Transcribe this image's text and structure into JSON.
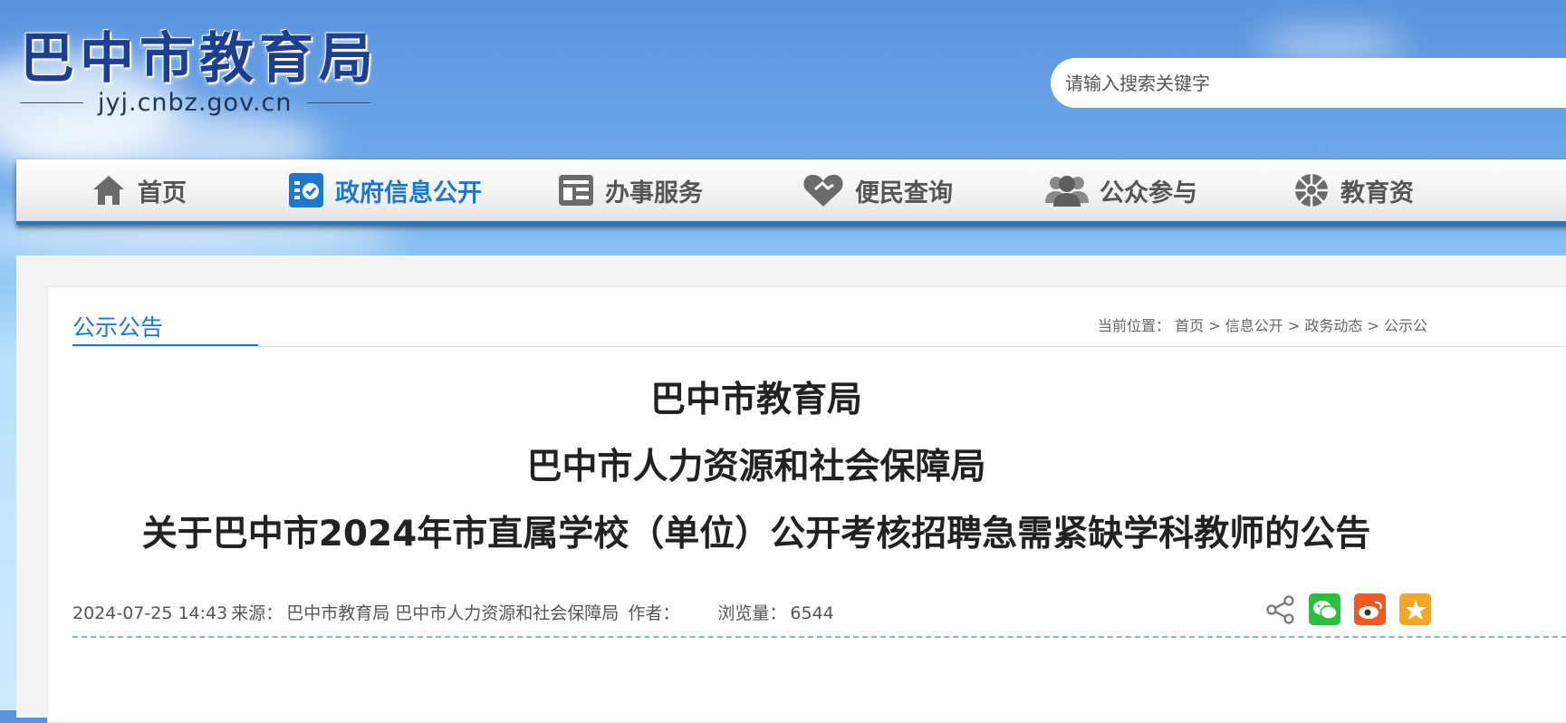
{
  "header": {
    "site_title": "巴中市教育局",
    "domain": "jyj.cnbz.gov.cn",
    "search_placeholder": "请输入搜索关键字"
  },
  "nav": {
    "items": [
      {
        "label": "首页",
        "icon": "home-icon"
      },
      {
        "label": "政府信息公开",
        "icon": "checklist-icon",
        "active": true
      },
      {
        "label": "办事服务",
        "icon": "service-icon"
      },
      {
        "label": "便民查询",
        "icon": "heart-icon"
      },
      {
        "label": "公众参与",
        "icon": "people-icon"
      },
      {
        "label": "教育资",
        "icon": "ball-icon"
      }
    ],
    "accent": "#1c78cf"
  },
  "column": {
    "title": "公示公告"
  },
  "breadcrumb": {
    "prefix": "当前位置：",
    "items": [
      "首页",
      "信息公开",
      "政务动态",
      "公示公"
    ],
    "separator": ">"
  },
  "article": {
    "title_lines": [
      "巴中市教育局",
      "巴中市人力资源和社会保障局",
      "关于巴中市2024年市直属学校（单位）公开考核招聘急需紧缺学科教师的公告"
    ],
    "meta": {
      "datetime": "2024-07-25 14:43",
      "source_label": "来源：",
      "source": "巴中市教育局 巴中市人力资源和社会保障局",
      "author_label": "作者：",
      "author": "",
      "views_label": "浏览量：",
      "views": "6544"
    },
    "share_icons": [
      "share-icon",
      "wechat-icon",
      "weibo-icon",
      "qzone-icon"
    ]
  }
}
